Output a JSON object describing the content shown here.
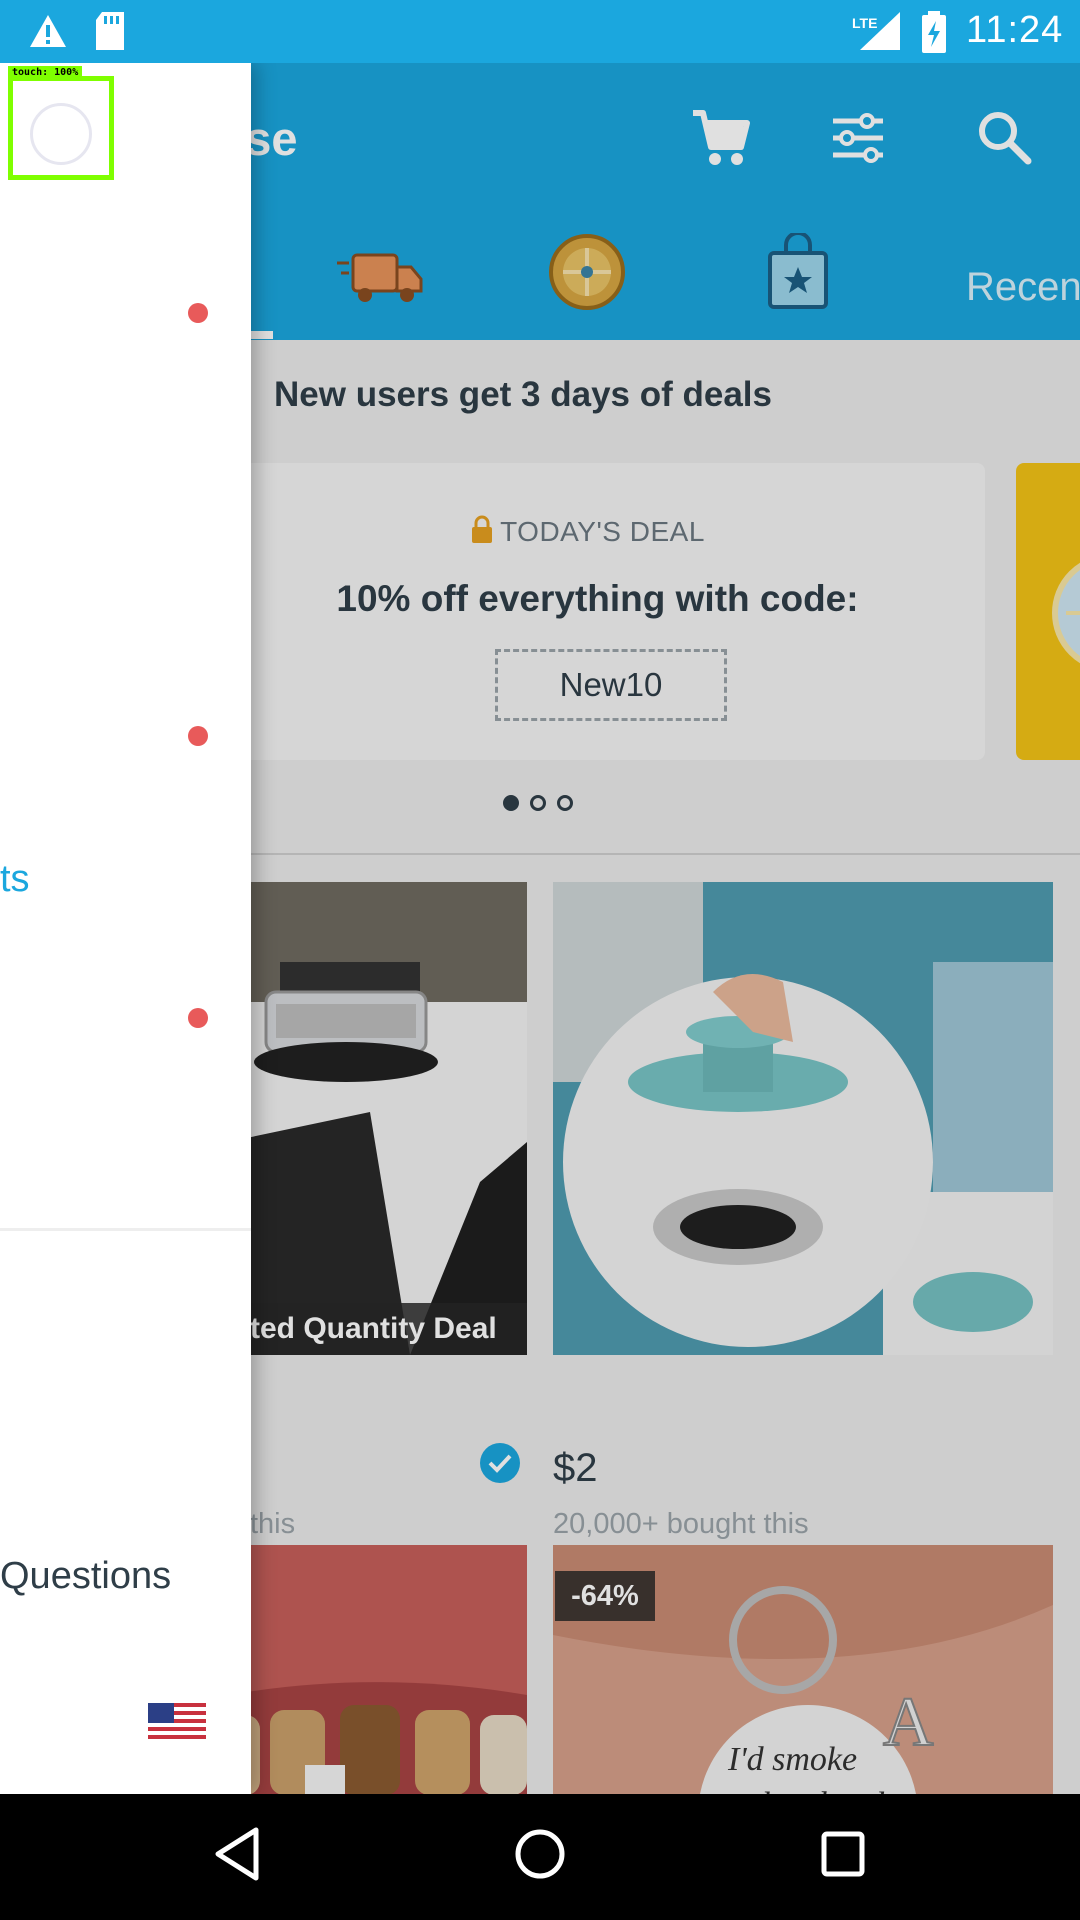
{
  "status_bar": {
    "time": "11:24",
    "network": "LTE",
    "icons": [
      "warning-icon",
      "sd-card-icon",
      "signal-icon",
      "battery-charging-icon"
    ]
  },
  "toolbar": {
    "title_fragment": "owse",
    "icons": [
      "cart-icon",
      "filter-icon",
      "search-icon"
    ]
  },
  "tabs": {
    "visible_text": "Recen",
    "icons": [
      "fast-shipping-icon",
      "wheel-icon",
      "shopping-bag-icon"
    ]
  },
  "banner": {
    "text": "New users get 3 days of deals"
  },
  "deal_card": {
    "label": "TODAY'S DEAL",
    "headline": "10% off everything with code:",
    "code": "New10"
  },
  "products": [
    {
      "banner": "ted Quantity Deal",
      "bought_fragment": "this"
    },
    {
      "price": "$2",
      "bought": "20,000+ bought this"
    },
    {
      "discount": "-64%"
    }
  ],
  "drawer": {
    "link_fragment": "ts",
    "faq_fragment": "Questions",
    "touch_label": "touch: 100%"
  },
  "colors": {
    "brand_blue": "#1ba7de",
    "dark_text": "#2f3e48",
    "notification_red": "#e85a5a",
    "deal_yellow": "#f3c316"
  }
}
